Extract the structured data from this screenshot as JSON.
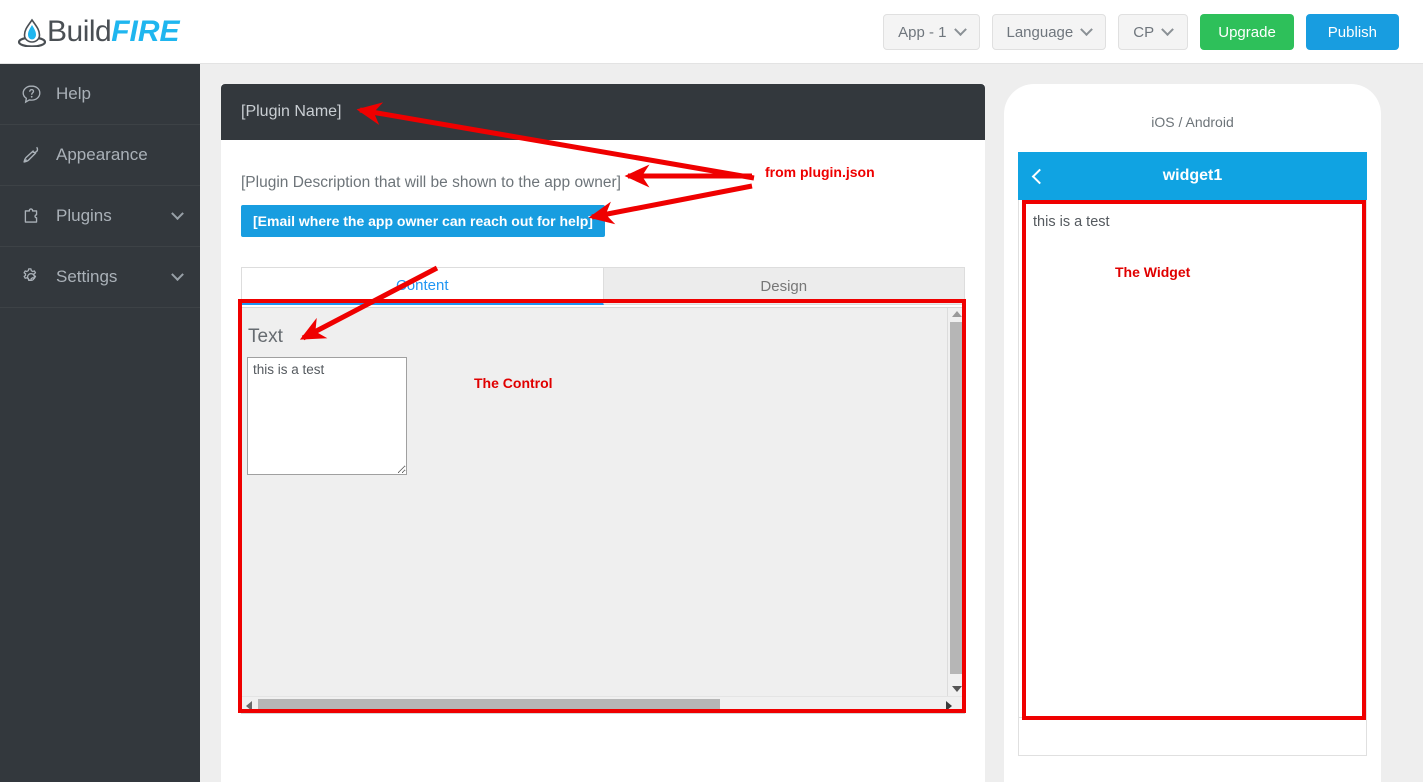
{
  "topbar": {
    "logo_build": "Build",
    "logo_fire": "FIRE",
    "logo_icon": "flame-icon",
    "app_selector": "App - 1",
    "language_selector": "Language",
    "cp_selector": "CP",
    "upgrade_label": "Upgrade",
    "publish_label": "Publish",
    "upgrade_color": "#2ec05a",
    "publish_color": "#189de0"
  },
  "sidebar": {
    "background": "#33383d",
    "items": [
      {
        "label": "Help",
        "icon": "help-bubble-icon",
        "has_chevron": false
      },
      {
        "label": "Appearance",
        "icon": "paint-roller-icon",
        "has_chevron": false
      },
      {
        "label": "Plugins",
        "icon": "puzzle-piece-icon",
        "has_chevron": true
      },
      {
        "label": "Settings",
        "icon": "gear-icon",
        "has_chevron": true
      }
    ]
  },
  "plugin": {
    "name": "[Plugin Name]",
    "description": "[Plugin Description that will be shown to the app owner]",
    "email_button": "[Email where the app owner can reach out for help]",
    "header_color": "#33383d"
  },
  "tabs": [
    {
      "label": "Content",
      "active": true
    },
    {
      "label": "Design",
      "active": false
    }
  ],
  "control": {
    "field_label": "Text",
    "textarea_value": "this is a test",
    "annotation": "The Control"
  },
  "preview": {
    "os_label": "iOS / Android",
    "title": "widget1",
    "back_icon": "chevron-left-icon",
    "header_color": "#10a3e2",
    "widget_text": "this is a test",
    "annotation": "The Widget"
  },
  "annotations": {
    "plugin_json_note": "from plugin.json",
    "color": "#ee0000"
  }
}
